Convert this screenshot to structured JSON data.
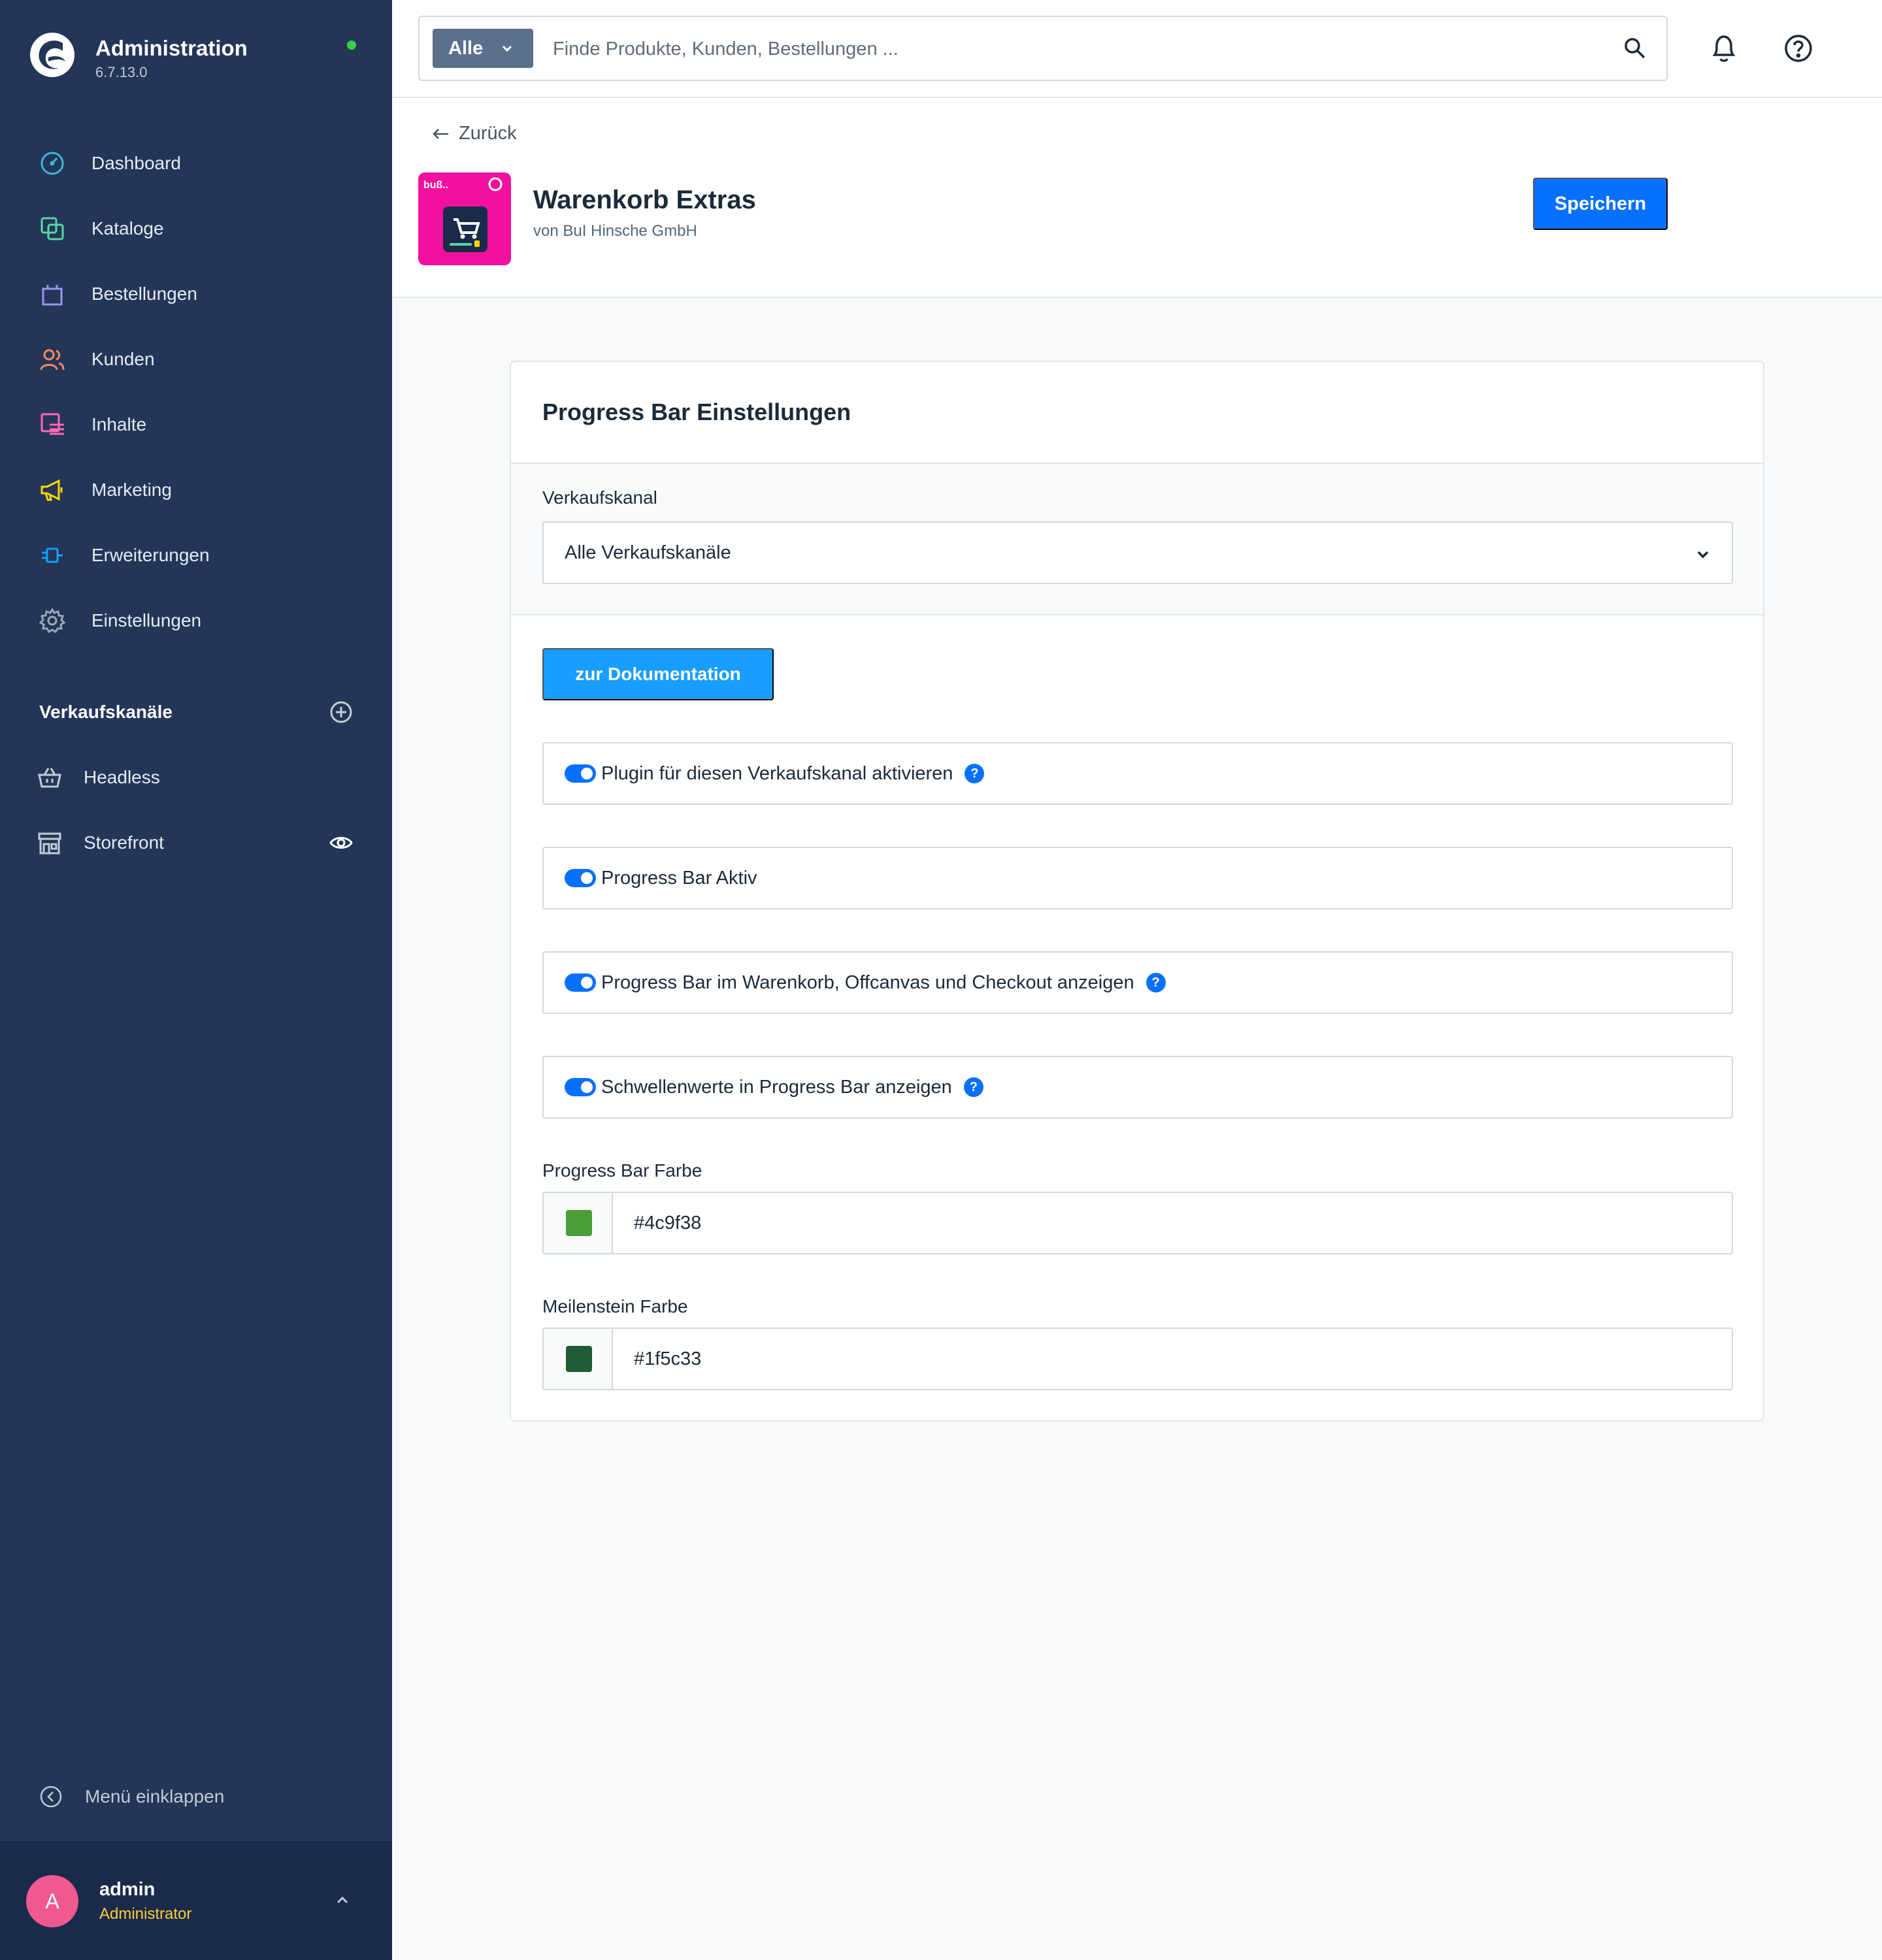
{
  "app": {
    "title": "Administration",
    "version": "6.7.13.0"
  },
  "sidebar": {
    "items": [
      {
        "label": "Dashboard",
        "icon": "dashboard-icon",
        "color": "#3fb6d9"
      },
      {
        "label": "Kataloge",
        "icon": "catalog-icon",
        "color": "#57d9a3"
      },
      {
        "label": "Bestellungen",
        "icon": "orders-icon",
        "color": "#a092f0"
      },
      {
        "label": "Kunden",
        "icon": "customers-icon",
        "color": "#f88962"
      },
      {
        "label": "Inhalte",
        "icon": "content-icon",
        "color": "#ff68b4"
      },
      {
        "label": "Marketing",
        "icon": "marketing-icon",
        "color": "#ffd700"
      },
      {
        "label": "Erweiterungen",
        "icon": "extensions-icon",
        "color": "#189eff"
      },
      {
        "label": "Einstellungen",
        "icon": "settings-icon",
        "color": "#9aa8b5"
      }
    ],
    "sales_channels": {
      "title": "Verkaufskanäle",
      "items": [
        {
          "label": "Headless",
          "icon": "basket-icon"
        },
        {
          "label": "Storefront",
          "icon": "storefront-icon"
        }
      ]
    },
    "collapse_label": "Menü einklappen",
    "user": {
      "initial": "A",
      "name": "admin",
      "role": "Administrator"
    }
  },
  "search": {
    "type_label": "Alle",
    "placeholder": "Finde Produkte, Kunden, Bestellungen ..."
  },
  "header": {
    "back_label": "Zurück",
    "app_title": "Warenkorb Extras",
    "vendor": "von BuI Hinsche GmbH",
    "save_label": "Speichern"
  },
  "card": {
    "title": "Progress Bar Einstellungen",
    "channel_label": "Verkaufskanal",
    "channel_value": "Alle Verkaufskanäle",
    "doc_button": "zur Dokumentation",
    "toggles": [
      {
        "label": "Plugin für diesen Verkaufskanal aktivieren",
        "checked": true,
        "help": true
      },
      {
        "label": "Progress Bar Aktiv",
        "checked": true,
        "help": false
      },
      {
        "label": "Progress Bar im Warenkorb, Offcanvas und Checkout anzeigen",
        "checked": true,
        "help": true
      },
      {
        "label": "Schwellenwerte in Progress Bar anzeigen",
        "checked": true,
        "help": true
      }
    ],
    "help_glyph": "?",
    "progress_color": {
      "label": "Progress Bar Farbe",
      "value": "#4c9f38"
    },
    "milestone_color": {
      "label": "Meilenstein Farbe",
      "value": "#1f5c33"
    }
  },
  "colors": {
    "sidebar_bg": "#233658",
    "primary": "#0870ff",
    "doc_button": "#189eff",
    "app_icon_bg": "#f2119e",
    "status_online": "#37d046"
  }
}
